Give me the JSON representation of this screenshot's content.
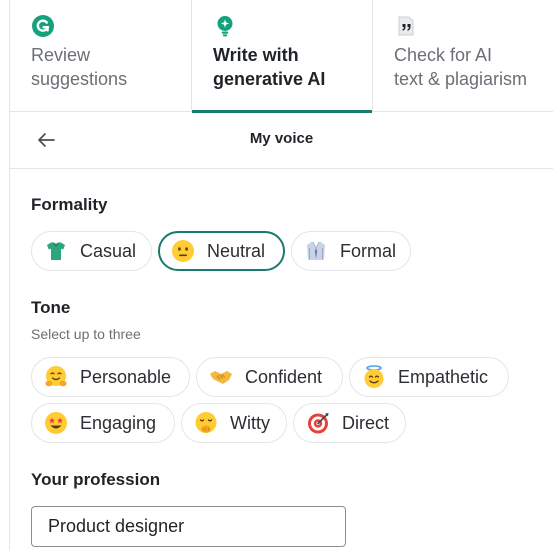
{
  "tabs": [
    {
      "label": "Review\nsuggestions",
      "icon": "grammarly-logo-icon",
      "active": false
    },
    {
      "label": "Write with\ngenerative AI",
      "icon": "lightbulb-icon",
      "active": true
    },
    {
      "label": "Check for AI\ntext & plagiarism",
      "icon": "quote-document-icon",
      "active": false
    }
  ],
  "header": {
    "title": "My voice",
    "back_icon": "arrow-left-icon"
  },
  "formality": {
    "title": "Formality",
    "options": [
      {
        "label": "Casual",
        "icon": "tshirt-icon",
        "selected": false
      },
      {
        "label": "Neutral",
        "icon": "neutral-face-icon",
        "selected": true
      },
      {
        "label": "Formal",
        "icon": "suit-icon",
        "selected": false
      }
    ]
  },
  "tone": {
    "title": "Tone",
    "subtitle": "Select up to three",
    "options": [
      {
        "label": "Personable",
        "icon": "hugging-face-icon"
      },
      {
        "label": "Confident",
        "icon": "handshake-icon"
      },
      {
        "label": "Empathetic",
        "icon": "smiling-halo-face-icon"
      },
      {
        "label": "Engaging",
        "icon": "star-struck-face-icon"
      },
      {
        "label": "Witty",
        "icon": "giggling-face-icon"
      },
      {
        "label": "Direct",
        "icon": "target-icon"
      }
    ]
  },
  "profession": {
    "title": "Your profession",
    "value": "Product designer"
  },
  "colors": {
    "accent": "#1a7a6b",
    "border": "#e3e5e8",
    "muted": "#6b6f76"
  }
}
